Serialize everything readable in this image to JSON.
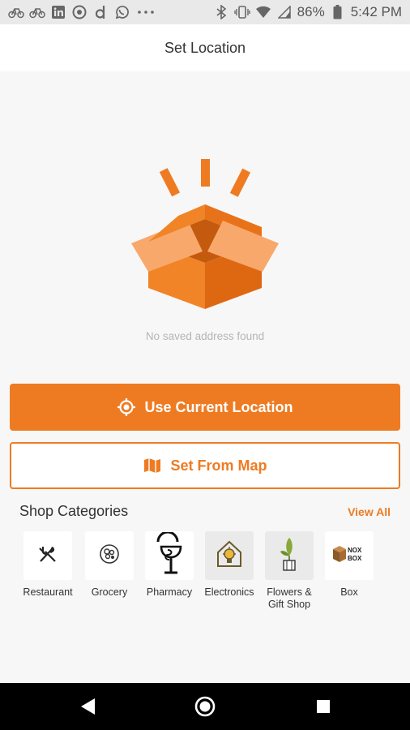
{
  "status_bar": {
    "battery": "86%",
    "time": "5:42 PM",
    "left_icons": [
      "bicycle-icon",
      "bicycle-icon",
      "linkedin-icon",
      "bitmoji-icon",
      "d-app-icon",
      "whatsapp-icon",
      "more-dots-icon"
    ],
    "right_icons": [
      "bluetooth-icon",
      "vibrate-icon",
      "wifi-icon",
      "signal-icon",
      "battery-icon"
    ]
  },
  "header": {
    "title": "Set Location"
  },
  "empty_state": {
    "message": "No saved address found",
    "illustration": "open-box-illustration"
  },
  "actions": {
    "current_location_label": "Use Current Location",
    "set_from_map_label": "Set From Map"
  },
  "shop_categories": {
    "title": "Shop Categories",
    "view_all": "View All",
    "items": [
      {
        "label": "Restaurant",
        "icon": "fork-knife-icon"
      },
      {
        "label": "Grocery",
        "icon": "grocery-icon"
      },
      {
        "label": "Pharmacy",
        "icon": "pharmacy-icon"
      },
      {
        "label": "Electronics",
        "icon": "lightbulb-icon"
      },
      {
        "label": "Flowers & Gift Shop",
        "icon": "plant-icon"
      },
      {
        "label": "Box",
        "icon": "box-icon"
      }
    ]
  },
  "nav": {
    "back": "back-icon",
    "home": "home-icon",
    "recents": "recents-icon"
  },
  "colors": {
    "accent": "#ee7b22",
    "background": "#f7f7f7"
  }
}
